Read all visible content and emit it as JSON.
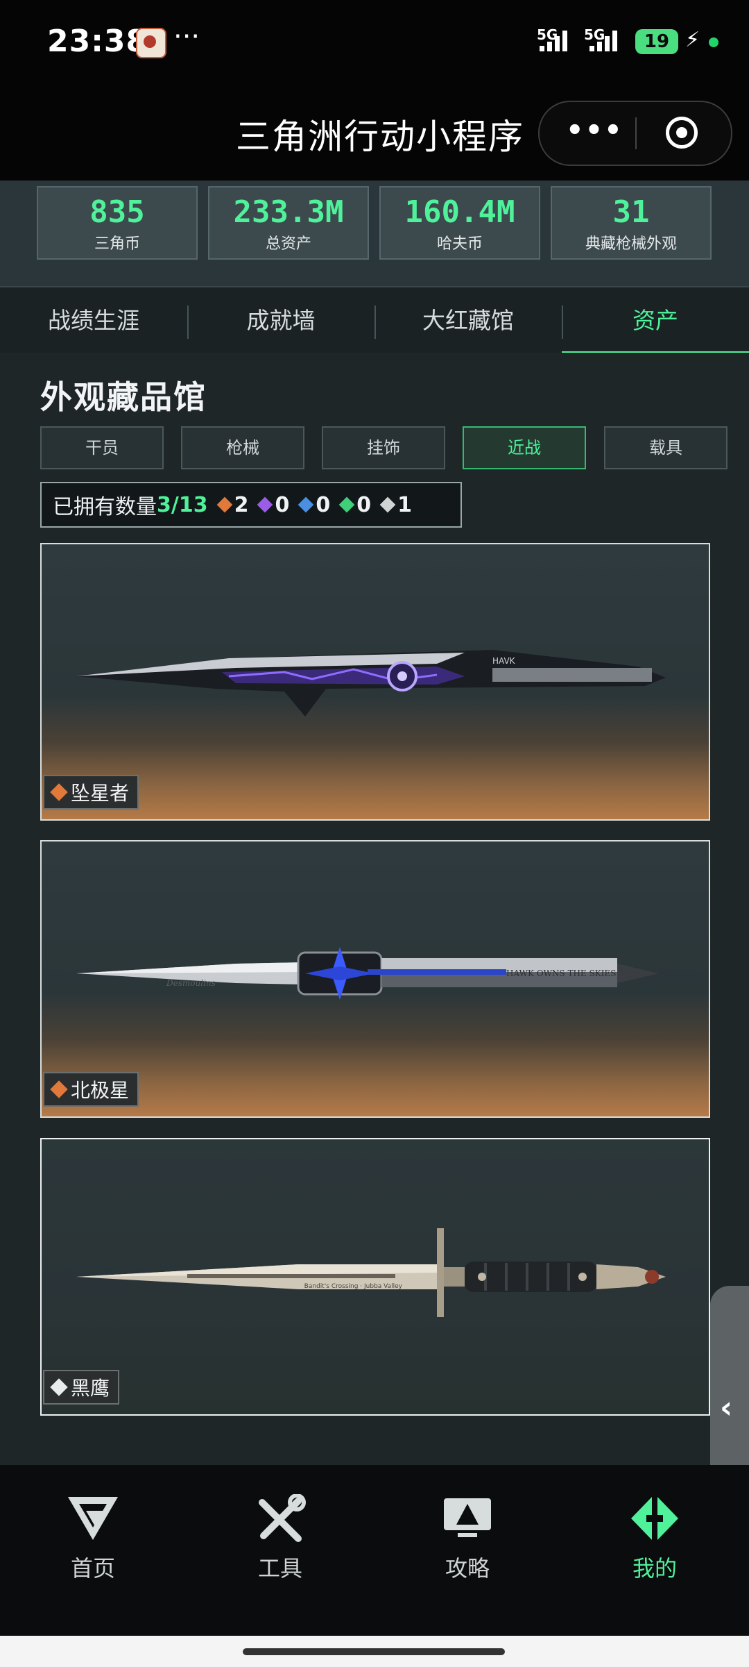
{
  "status_bar": {
    "time": "23:38",
    "overflow": "···",
    "network1": "5G",
    "network2": "5G",
    "battery": "19"
  },
  "title_bar": {
    "title": "三角洲行动小程序",
    "more": "•••"
  },
  "stats": [
    {
      "value": "835",
      "label": "三角币"
    },
    {
      "value": "233.3M",
      "label": "总资产"
    },
    {
      "value": "160.4M",
      "label": "哈夫币"
    },
    {
      "value": "31",
      "label": "典藏枪械外观"
    }
  ],
  "tabs": [
    "战绩生涯",
    "成就墙",
    "大红藏馆",
    "资产"
  ],
  "active_tab": "资产",
  "section_title": "外观藏品馆",
  "filters": [
    "干员",
    "枪械",
    "挂饰",
    "近战",
    "载具"
  ],
  "active_filter": "近战",
  "owned": {
    "label": "已拥有数量",
    "count": "3/13",
    "rarities": [
      {
        "color": "#e0793a",
        "count": "2"
      },
      {
        "color": "#9b5de5",
        "count": "0"
      },
      {
        "color": "#4a8fe0",
        "count": "0"
      },
      {
        "color": "#3fcf7a",
        "count": "0"
      },
      {
        "color": "#d0d4d5",
        "count": "1"
      }
    ]
  },
  "items": [
    {
      "name": "坠星者",
      "rarity_color": "#e0793a",
      "engraving": "HAVK"
    },
    {
      "name": "北极星",
      "rarity_color": "#e0793a",
      "engraving": "Desmoulins",
      "engraving2": "HAWK OWNS THE SKIES"
    },
    {
      "name": "黑鹰",
      "rarity_color": "#e8ecec",
      "engraving": "Bandit's Crossing · Jubba Valley"
    }
  ],
  "side_tab": "‹",
  "bottom_nav": [
    "首页",
    "工具",
    "攻略",
    "我的"
  ],
  "active_nav": "我的",
  "colors": {
    "accent": "#4ff29a",
    "background": "#1f2628"
  }
}
